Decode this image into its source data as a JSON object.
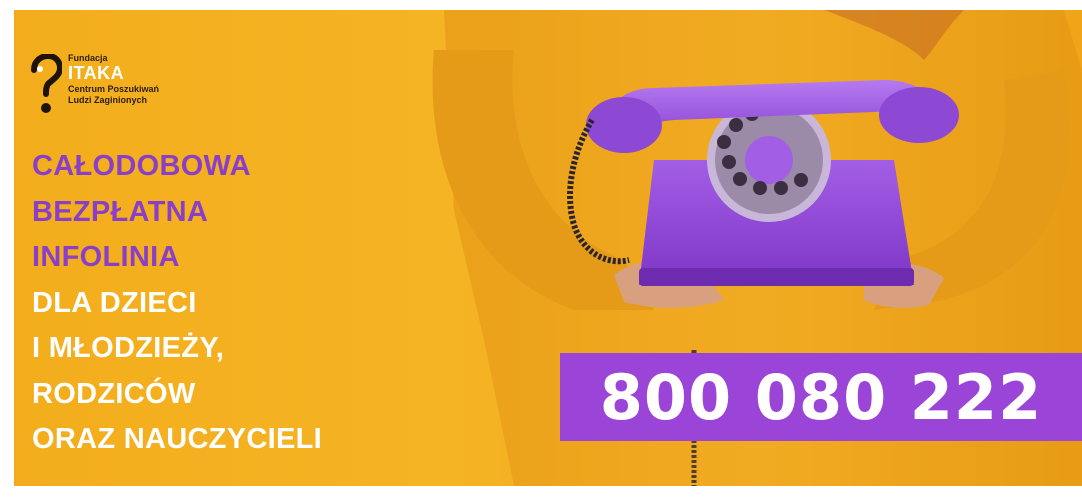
{
  "logo": {
    "top_label": "Fundacja",
    "name": "ITAKA",
    "subtitle_line1": "Centrum Poszukiwań",
    "subtitle_line2": "Ludzi Zaginionych",
    "mark_icon": "question-mark-logo-icon"
  },
  "headline": {
    "line1": "CAŁODOBOWA",
    "line2": "BEZPŁATNA",
    "line3": "INFOLINIA",
    "line4": "DLA DZIECI",
    "line5": "I MŁODZIEŻY,",
    "line6": "RODZICÓW",
    "line7": "ORAZ NAUCZYCIELI"
  },
  "phone_number": "800 080 222",
  "colors": {
    "background": "#f3ad1c",
    "accent_purple": "#8a3fc8",
    "number_box": "#9a45d8",
    "text_white": "#ffffff"
  }
}
